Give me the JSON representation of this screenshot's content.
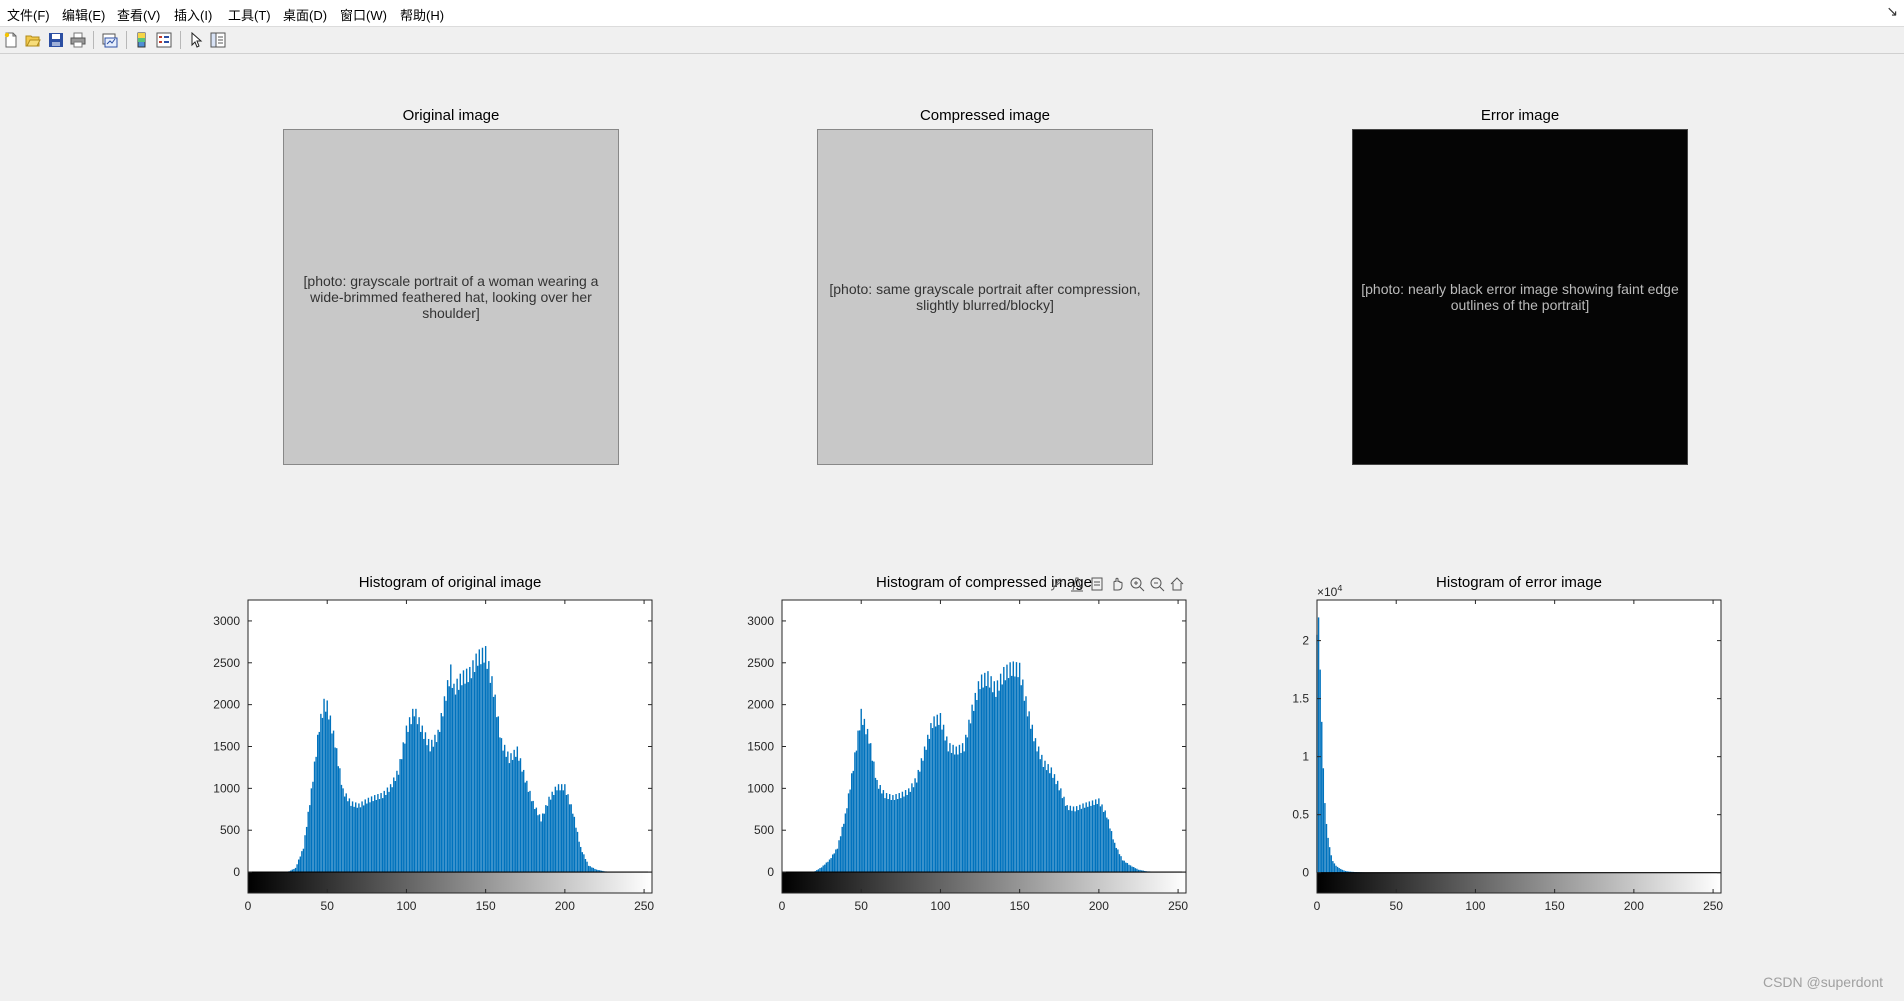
{
  "menu": [
    "文件(F)",
    "编辑(E)",
    "查看(V)",
    "插入(I)",
    "工具(T)",
    "桌面(D)",
    "窗口(W)",
    "帮助(H)"
  ],
  "menu_arrow": "↘",
  "toolbar_icons": [
    "new-figure-icon",
    "open-file-icon",
    "save-icon",
    "print-icon",
    "link-plot-icon",
    "insert-colorbar-icon",
    "insert-legend-icon",
    "edit-plot-icon",
    "property-inspector-icon"
  ],
  "images": [
    {
      "title": "Original image",
      "placeholder": "[photo: grayscale portrait of a woman wearing a wide-brimmed feathered hat, looking over her shoulder]"
    },
    {
      "title": "Compressed image",
      "placeholder": "[photo: same grayscale portrait after compression, slightly blurred/blocky]"
    },
    {
      "title": "Error image",
      "placeholder": "[photo: nearly black error image showing faint edge outlines of the portrait]"
    }
  ],
  "axes_toolbar_icons": [
    "brush-icon",
    "data-tips-icon",
    "export-icon",
    "pan-hand-icon",
    "zoom-in-icon",
    "zoom-out-icon",
    "home-icon"
  ],
  "watermark": "CSDN @superdont",
  "colors": {
    "bar": "#0072bd",
    "background": "#f0f0f0",
    "axes": "#ffffff"
  },
  "chart_data": [
    {
      "type": "bar",
      "title": "Histogram of original image",
      "xlabel": "",
      "ylabel": "",
      "xlim": [
        0,
        255
      ],
      "ylim": [
        -250,
        3250
      ],
      "xticks": [
        0,
        50,
        100,
        150,
        200,
        250
      ],
      "yticks": [
        0,
        500,
        1000,
        1500,
        2000,
        2500,
        3000
      ],
      "ytick_labels": [
        "0",
        "500",
        "1000",
        "1500",
        "2000",
        "2500",
        "3000"
      ],
      "colorbar": "gray",
      "x": [
        25,
        30,
        35,
        40,
        45,
        48,
        50,
        55,
        60,
        65,
        70,
        75,
        80,
        85,
        90,
        95,
        100,
        105,
        110,
        115,
        120,
        125,
        128,
        130,
        135,
        140,
        145,
        150,
        155,
        160,
        165,
        170,
        175,
        180,
        185,
        190,
        195,
        200,
        205,
        210,
        215,
        220,
        225,
        230
      ],
      "values": [
        0,
        50,
        300,
        1000,
        1800,
        2070,
        2050,
        1600,
        1000,
        850,
        820,
        880,
        920,
        950,
        1050,
        1250,
        1750,
        2000,
        1750,
        1550,
        1700,
        2200,
        2480,
        2250,
        2400,
        2450,
        2650,
        2700,
        2250,
        1600,
        1400,
        1500,
        1150,
        850,
        650,
        900,
        1050,
        1050,
        750,
        300,
        80,
        30,
        10,
        0
      ]
    },
    {
      "type": "bar",
      "title": "Histogram of compressed image",
      "xlabel": "",
      "ylabel": "",
      "xlim": [
        0,
        255
      ],
      "ylim": [
        -250,
        3250
      ],
      "xticks": [
        0,
        50,
        100,
        150,
        200,
        250
      ],
      "yticks": [
        0,
        500,
        1000,
        1500,
        2000,
        2500,
        3000
      ],
      "ytick_labels": [
        "0",
        "500",
        "1000",
        "1500",
        "2000",
        "2500",
        "3000"
      ],
      "colorbar": "gray",
      "x": [
        20,
        25,
        30,
        35,
        40,
        45,
        50,
        55,
        60,
        65,
        70,
        75,
        80,
        85,
        90,
        95,
        100,
        105,
        110,
        115,
        120,
        125,
        130,
        135,
        140,
        145,
        150,
        155,
        160,
        165,
        170,
        175,
        180,
        185,
        190,
        195,
        200,
        205,
        210,
        215,
        220,
        225,
        230,
        235,
        240
      ],
      "values": [
        0,
        60,
        150,
        300,
        700,
        1300,
        1950,
        1650,
        1100,
        950,
        920,
        950,
        1000,
        1150,
        1500,
        1850,
        1900,
        1550,
        1500,
        1550,
        2000,
        2350,
        2400,
        2250,
        2450,
        2520,
        2500,
        2000,
        1600,
        1350,
        1250,
        1050,
        800,
        780,
        820,
        850,
        880,
        700,
        350,
        150,
        80,
        30,
        10,
        5,
        0
      ]
    },
    {
      "type": "bar",
      "title": "Histogram of error image",
      "xlabel": "",
      "ylabel": "",
      "xlim": [
        0,
        255
      ],
      "ylim": [
        -1750,
        23500
      ],
      "xticks": [
        0,
        50,
        100,
        150,
        200,
        250
      ],
      "yticks": [
        0,
        5000,
        10000,
        15000,
        20000
      ],
      "ytick_labels": [
        "0",
        "0.5",
        "1",
        "1.5",
        "2"
      ],
      "multiplier": "×10",
      "multiplier_exp": "4",
      "colorbar": "gray",
      "x": [
        0,
        1,
        2,
        3,
        4,
        5,
        6,
        7,
        8,
        9,
        10,
        12,
        14,
        16,
        18,
        20,
        25,
        30,
        40
      ],
      "values": [
        20500,
        22000,
        17500,
        13000,
        9000,
        6000,
        4200,
        3000,
        2200,
        1500,
        1000,
        600,
        400,
        250,
        150,
        100,
        50,
        20,
        0
      ]
    }
  ]
}
